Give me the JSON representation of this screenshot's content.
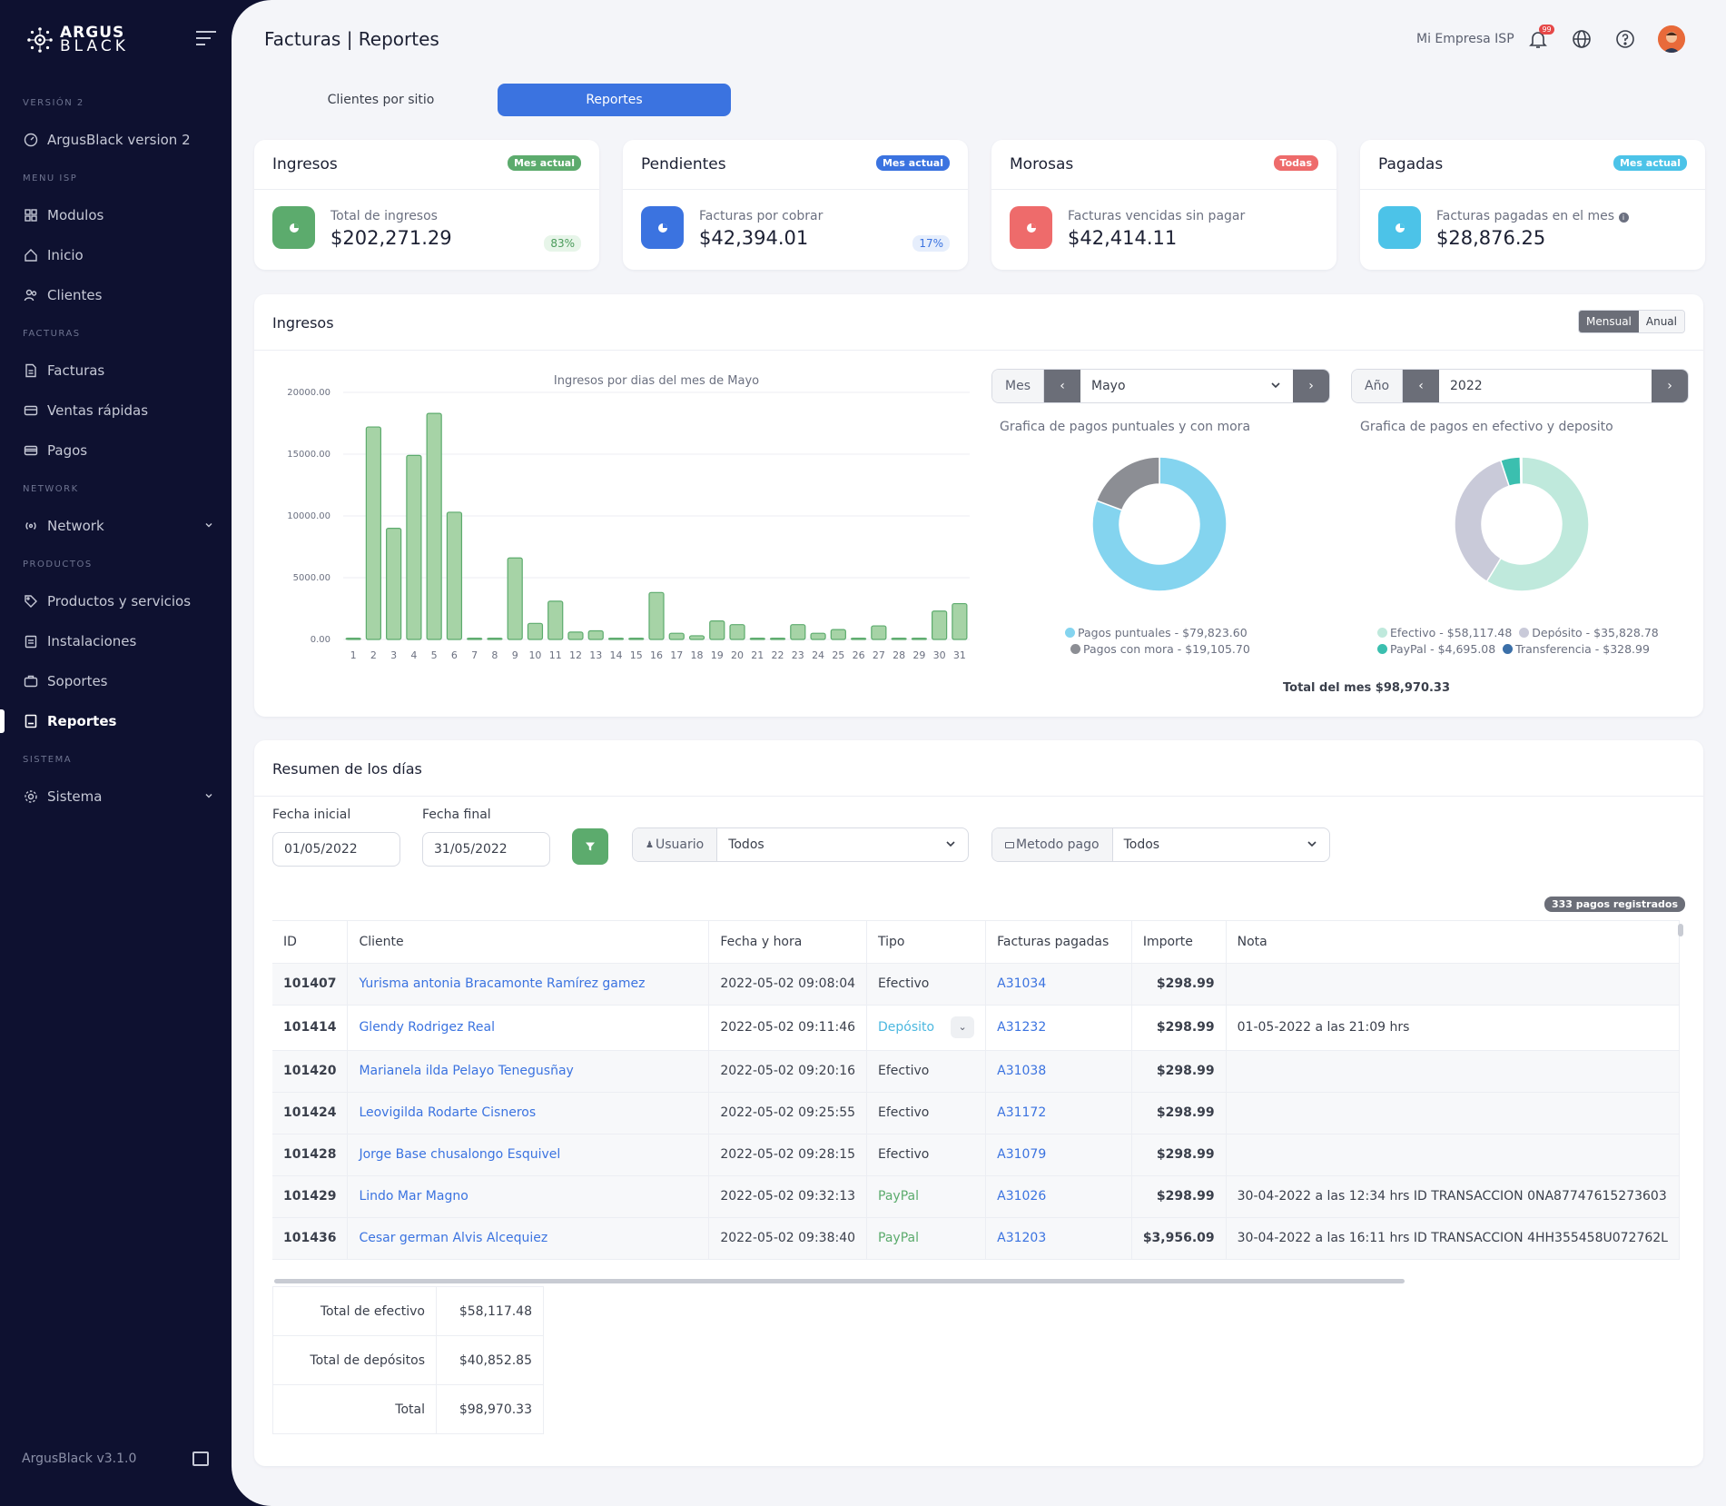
{
  "app": {
    "logo_line1": "ARGUS",
    "logo_line2": "BLACK",
    "page_title": "Facturas | Reportes",
    "company": "Mi Empresa ISP",
    "notif_count": "99",
    "footer": "ArgusBlack v3.1.0"
  },
  "sidebar": {
    "sections": {
      "version": "VERSIÓN 2",
      "menu_isp": "MENU ISP",
      "facturas": "FACTURAS",
      "network": "NETWORK",
      "productos": "PRODUCTOS",
      "sistema": "SISTEMA"
    },
    "items": {
      "argusblack": "ArgusBlack version 2",
      "modulos": "Modulos",
      "inicio": "Inicio",
      "clientes": "Clientes",
      "facturas": "Facturas",
      "ventas": "Ventas rápidas",
      "pagos": "Pagos",
      "network": "Network",
      "productos": "Productos y servicios",
      "instalaciones": "Instalaciones",
      "soportes": "Soportes",
      "reportes": "Reportes",
      "sistema": "Sistema"
    }
  },
  "tabs": [
    "Clientes por sitio",
    "Reportes"
  ],
  "stats": [
    {
      "title": "Ingresos",
      "badge": "Mes actual",
      "label": "Total de ingresos",
      "value": "$202,271.29",
      "pct": "83%",
      "color": "#5cab6d"
    },
    {
      "title": "Pendientes",
      "badge": "Mes actual",
      "label": "Facturas por cobrar",
      "value": "$42,394.01",
      "pct": "17%",
      "color": "#3b73e0"
    },
    {
      "title": "Morosas",
      "badge": "Todas",
      "label": "Facturas vencidas sin pagar",
      "value": "$42,414.11",
      "pct": "",
      "color": "#ee6b6b"
    },
    {
      "title": "Pagadas",
      "badge": "Mes actual",
      "label": "Facturas pagadas en el mes",
      "value": "$28,876.25",
      "pct": "",
      "color": "#4cc3e8"
    }
  ],
  "ingresos": {
    "title": "Ingresos",
    "toggle_on": "Mensual",
    "toggle_off": "Anual",
    "mes_label": "Mes",
    "mes_value": "Mayo",
    "anio_label": "Año",
    "anio_value": "2022",
    "total_mes": "Total del mes $98,970.33"
  },
  "chart_data": [
    {
      "type": "bar",
      "title": "Ingresos por dias del mes de Mayo",
      "categories": [
        "1",
        "2",
        "3",
        "4",
        "5",
        "6",
        "7",
        "8",
        "9",
        "10",
        "11",
        "12",
        "13",
        "14",
        "15",
        "16",
        "17",
        "18",
        "19",
        "20",
        "21",
        "22",
        "23",
        "24",
        "25",
        "26",
        "27",
        "28",
        "29",
        "30",
        "31"
      ],
      "values": [
        100,
        17200,
        9000,
        14900,
        18300,
        10300,
        100,
        100,
        6600,
        1300,
        3100,
        600,
        700,
        100,
        100,
        3800,
        500,
        300,
        1500,
        1200,
        100,
        100,
        1200,
        500,
        800,
        100,
        1100,
        100,
        100,
        2300,
        2900
      ],
      "y_ticks": [
        "20000.00",
        "15000.00",
        "10000.00",
        "5000.00",
        "0.00"
      ],
      "ylim": [
        0,
        20000
      ],
      "color": "#a6d3a6"
    },
    {
      "type": "pie",
      "title": "Grafica de pagos puntuales y con mora",
      "labels": [
        "Pagos puntuales - $79,823.60",
        "Pagos con mora - $19,105.70"
      ],
      "values": [
        79823.6,
        19105.7
      ],
      "colors": [
        "#84d4ef",
        "#8c8e94"
      ]
    },
    {
      "type": "pie",
      "title": "Grafica de pagos en efectivo y deposito",
      "labels": [
        "Efectivo - $58,117.48",
        "Depósito - $35,828.78",
        "PayPal - $4,695.08",
        "Transferencia - $328.99"
      ],
      "values": [
        58117.48,
        35828.78,
        4695.08,
        328.99
      ],
      "colors": [
        "#bfe9dc",
        "#c9cad9",
        "#3bbfaf",
        "#3b6fa8"
      ]
    }
  ],
  "resumen": {
    "title": "Resumen de los días",
    "fecha_inicial_label": "Fecha inicial",
    "fecha_inicial": "01/05/2022",
    "fecha_final_label": "Fecha final",
    "fecha_final": "31/05/2022",
    "usuario_label": "Usuario",
    "usuario_value": "Todos",
    "metodo_label": "Metodo pago",
    "metodo_value": "Todos",
    "count": "333 pagos registrados"
  },
  "table": {
    "headers": [
      "ID",
      "Cliente",
      "Fecha y hora",
      "Tipo",
      "Facturas pagadas",
      "Importe",
      "Nota"
    ],
    "rows": [
      {
        "id": "101407",
        "client": "Yurisma antonia Bracamonte Ramírez gamez",
        "date": "2022-05-02 09:08:04",
        "tipo": "Efectivo",
        "inv": "A31034",
        "amt": "$298.99",
        "nota": ""
      },
      {
        "id": "101414",
        "client": "Glendy Rodrigez Real",
        "date": "2022-05-02 09:11:46",
        "tipo": "Depósito",
        "inv": "A31232",
        "amt": "$298.99",
        "nota": "01-05-2022 a las 21:09 hrs"
      },
      {
        "id": "101420",
        "client": "Marianela ilda Pelayo Tenegusñay",
        "date": "2022-05-02 09:20:16",
        "tipo": "Efectivo",
        "inv": "A31038",
        "amt": "$298.99",
        "nota": ""
      },
      {
        "id": "101424",
        "client": "Leovigilda Rodarte Cisneros",
        "date": "2022-05-02 09:25:55",
        "tipo": "Efectivo",
        "inv": "A31172",
        "amt": "$298.99",
        "nota": ""
      },
      {
        "id": "101428",
        "client": "Jorge Base chusalongo Esquivel",
        "date": "2022-05-02 09:28:15",
        "tipo": "Efectivo",
        "inv": "A31079",
        "amt": "$298.99",
        "nota": ""
      },
      {
        "id": "101429",
        "client": "Lindo Mar Magno",
        "date": "2022-05-02 09:32:13",
        "tipo": "PayPal",
        "inv": "A31026",
        "amt": "$298.99",
        "nota": "30-04-2022 a las 12:34 hrs ID TRANSACCION 0NA87747615273603"
      },
      {
        "id": "101436",
        "client": "Cesar german Alvis Alcequiez",
        "date": "2022-05-02 09:38:40",
        "tipo": "PayPal",
        "inv": "A31203",
        "amt": "$3,956.09",
        "nota": "30-04-2022 a las 16:11 hrs ID TRANSACCION 4HH355458U072762L"
      }
    ]
  },
  "totals": [
    {
      "label": "Total de efectivo",
      "value": "$58,117.48"
    },
    {
      "label": "Total de depósitos",
      "value": "$40,852.85"
    },
    {
      "label": "Total",
      "value": "$98,970.33"
    }
  ]
}
